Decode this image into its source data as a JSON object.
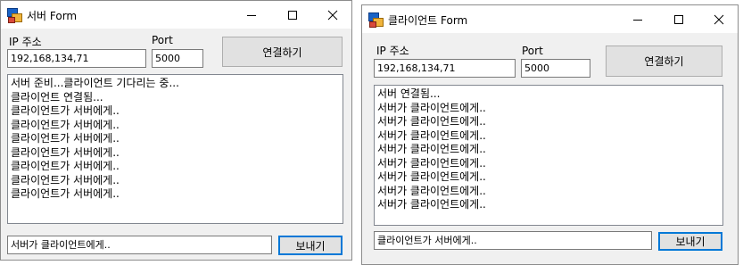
{
  "server": {
    "title": "서버 Form",
    "ip_label": "IP 주소",
    "ip_value": "192,168,134,71",
    "port_label": "Port",
    "port_value": "5000",
    "connect_label": "연결하기",
    "log": [
      "서버 준비...클라이언트 기다리는 중...",
      "클라이언트 연결됨...",
      "클라이언트가 서버에게..",
      "클라이언트가 서버에게..",
      "클라이언트가 서버에게..",
      "클라이언트가 서버에게..",
      "클라이언트가 서버에게..",
      "클라이언트가 서버에게..",
      "클라이언트가 서버에게.."
    ],
    "message_value": "서버가 클라이언트에게..",
    "send_label": "보내기"
  },
  "client": {
    "title": "클라이언트 Form",
    "ip_label": "IP 주소",
    "ip_value": "192,168,134,71",
    "port_label": "Port",
    "port_value": "5000",
    "connect_label": "연결하기",
    "log": [
      "서버 연결됨...",
      "서버가 클라이언트에게..",
      "서버가 클라이언트에게..",
      "서버가 클라이언트에게..",
      "서버가 클라이언트에게..",
      "서버가 클라이언트에게..",
      "서버가 클라이언트에게..",
      "서버가 클라이언트에게..",
      "서버가 클라이언트에게.."
    ],
    "message_value": "클라이언트가 서버에게..",
    "send_label": "보내기"
  },
  "window_controls": {
    "minimize": "minimize-icon",
    "maximize": "maximize-icon",
    "close": "close-icon"
  }
}
